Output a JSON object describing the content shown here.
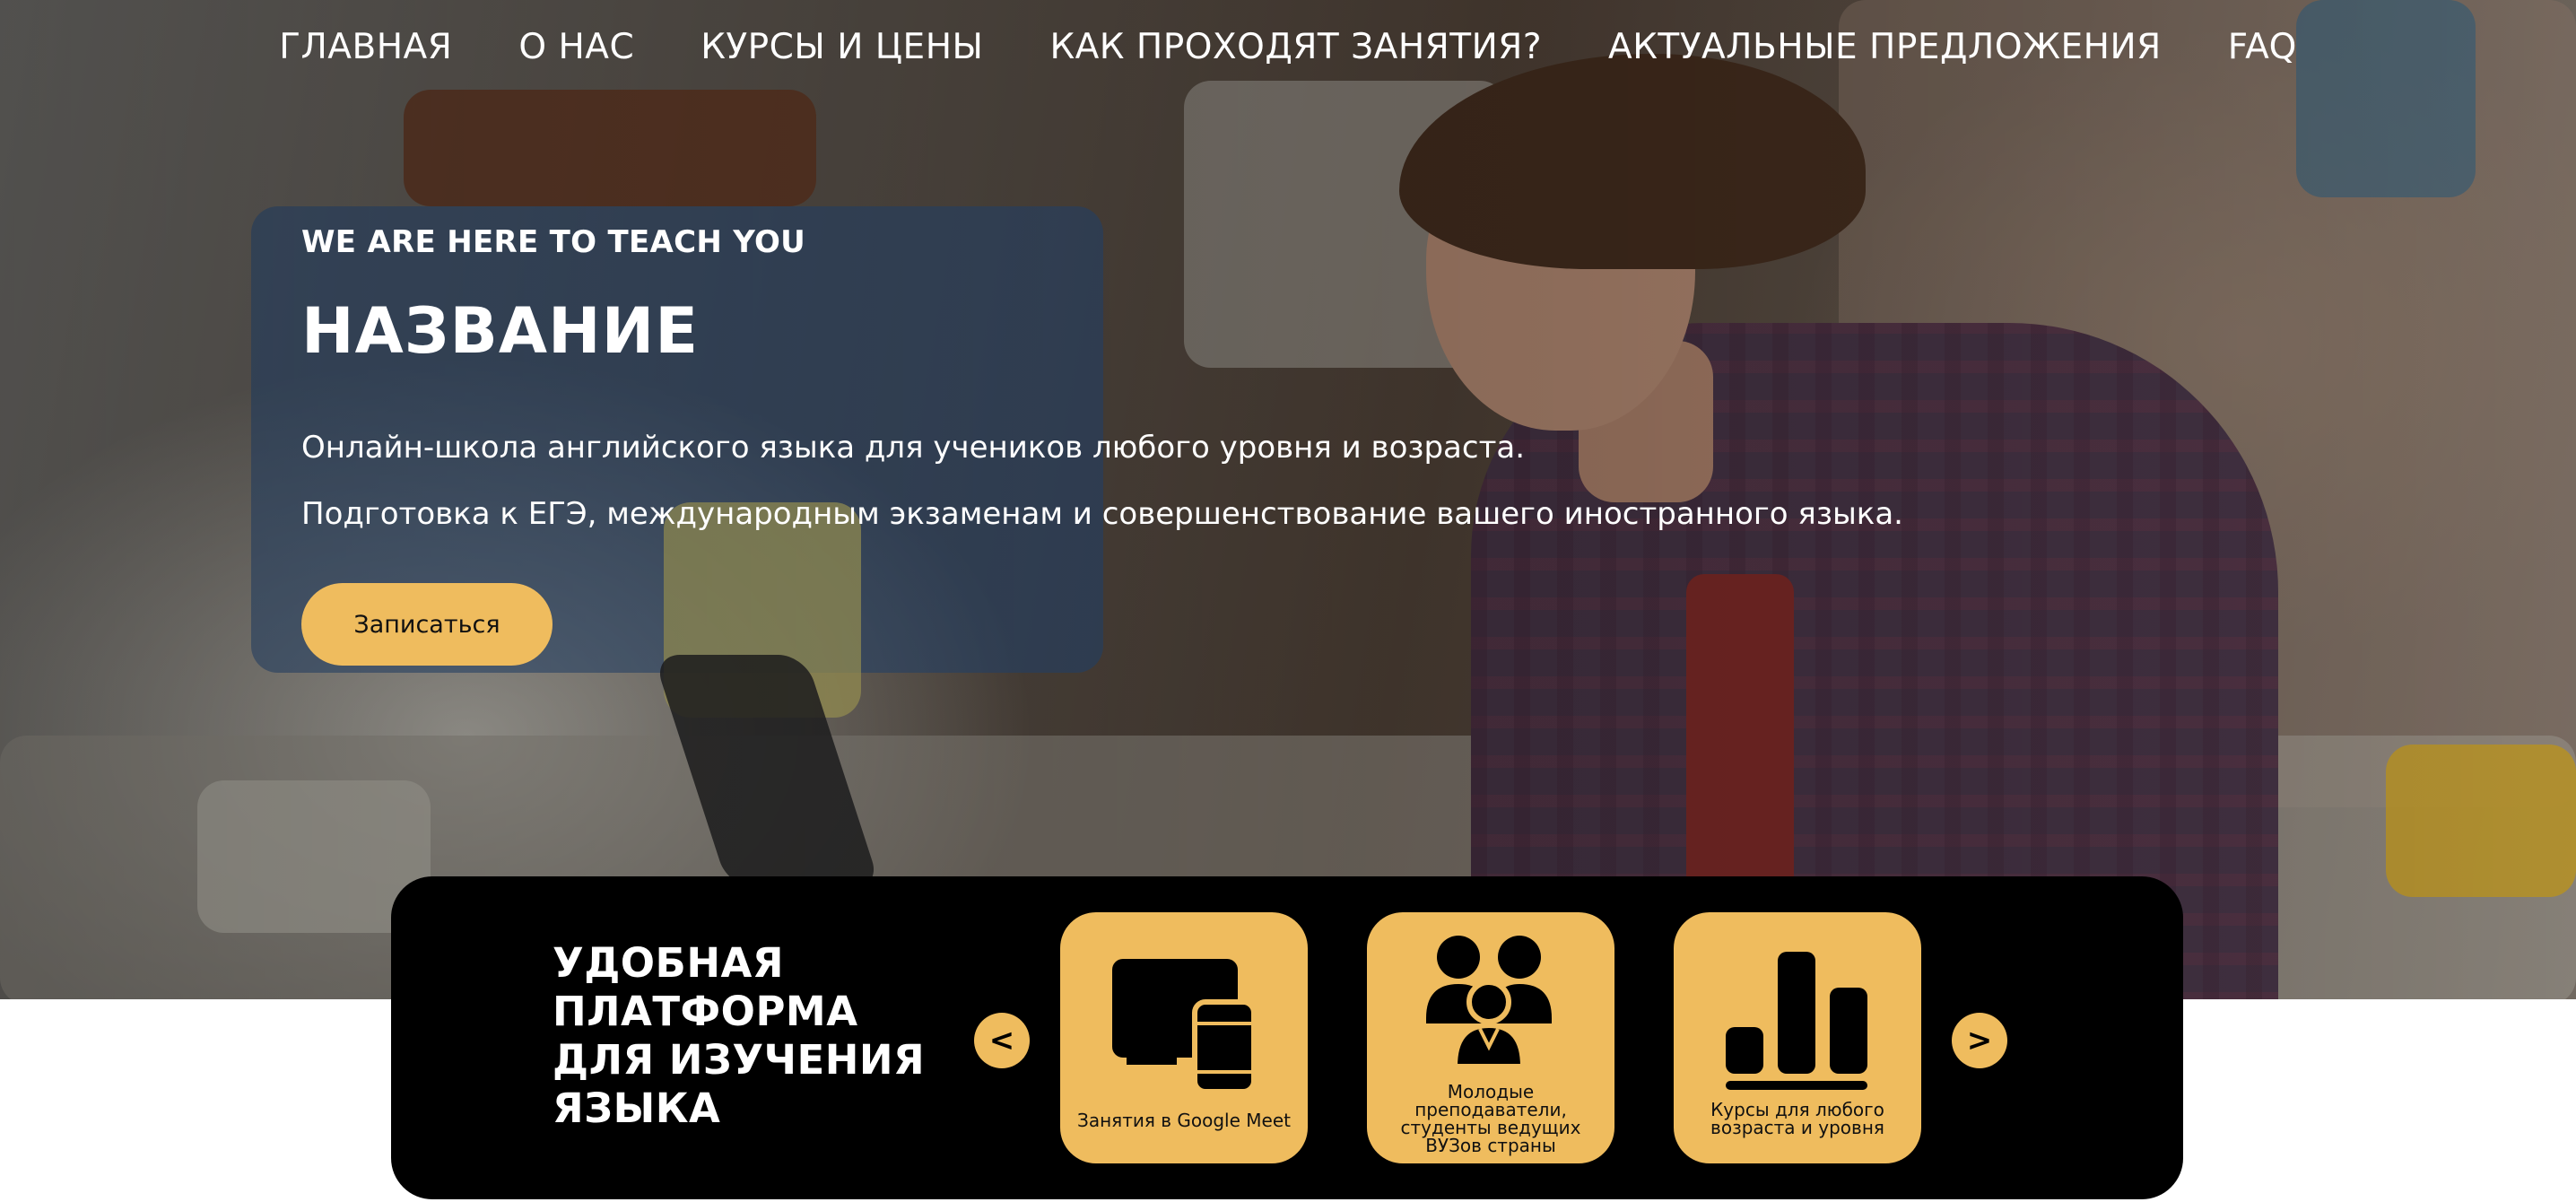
{
  "nav": {
    "items": [
      {
        "label": "ГЛАВНАЯ"
      },
      {
        "label": "О НАС"
      },
      {
        "label": "КУРСЫ И ЦЕНЫ"
      },
      {
        "label": "КАК ПРОХОДЯТ ЗАНЯТИЯ?"
      },
      {
        "label": "АКТУАЛЬНЫЕ ПРЕДЛОЖЕНИЯ"
      },
      {
        "label": "FAQ"
      }
    ]
  },
  "hero": {
    "tagline": "WE ARE HERE TO TEACH YOU",
    "title": "НАЗВАНИЕ",
    "description_1": "Онлайн-школа английского языка для учеников любого уровня и возраста.",
    "description_2": "Подготовка к ЕГЭ, международным экзаменам и совершенствование вашего иностранного языка.",
    "cta_label": "Записаться"
  },
  "features": {
    "title_lines": [
      "УДОБНАЯ",
      "ПЛАТФОРМА",
      "ДЛЯ ИЗУЧЕНИЯ",
      "ЯЗЫКА"
    ],
    "prev_label": "<",
    "next_label": ">",
    "cards": [
      {
        "icon": "devices-icon",
        "label": "Занятия в Google Meet"
      },
      {
        "icon": "people-group-icon",
        "label": "Молодые преподаватели, студенты ведущих ВУЗов страны"
      },
      {
        "icon": "bar-chart-icon",
        "label": "Курсы для любого возраста и уровня"
      }
    ]
  },
  "colors": {
    "accent": "#efbc5e",
    "panel_bg": "#000000",
    "text_light": "#ffffff"
  }
}
